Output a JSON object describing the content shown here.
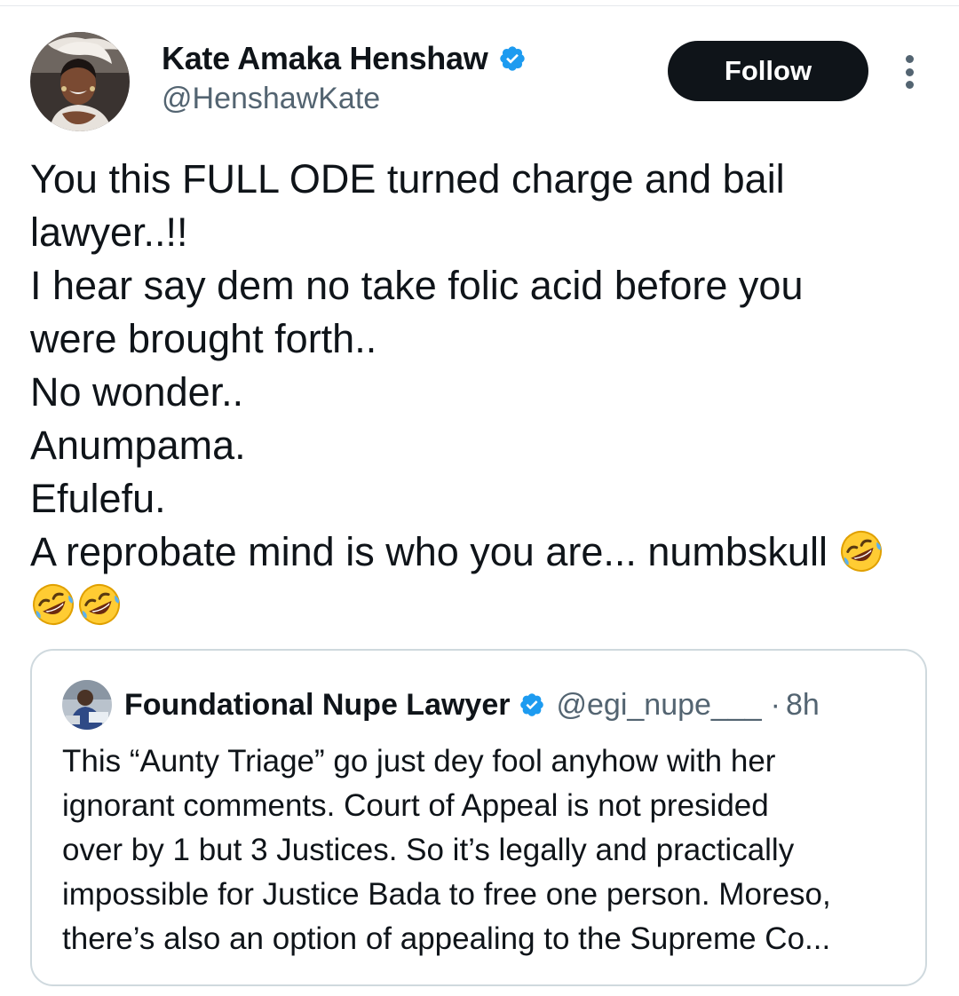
{
  "author": {
    "display_name": "Kate Amaka Henshaw",
    "handle": "@HenshawKate",
    "verified": true,
    "avatar_icon": "profile-photo"
  },
  "follow_button": {
    "label": "Follow"
  },
  "more_button": {
    "icon": "more-options-icon"
  },
  "tweet": {
    "lines": [
      "You this FULL ODE turned charge and bail",
      "lawyer..!!",
      "I hear say dem no take folic acid before you",
      "were brought forth..",
      "No wonder..",
      "Anumpama.",
      "Efulefu.",
      "A reprobate mind is who you are... numbskull"
    ],
    "emoji": "rolling-on-the-floor-laughing",
    "emoji_count_inline": 1,
    "emoji_count_next_line": 2
  },
  "quoted_tweet": {
    "display_name": "Foundational Nupe Lawyer",
    "handle": "@egi_nupe___",
    "separator": "·",
    "time": "8h",
    "verified": true,
    "lines": [
      "This “Aunty Triage” go just dey fool anyhow with her",
      "ignorant comments. Court of Appeal is not presided",
      "over by 1 but 3 Justices. So it’s legally and practically",
      "impossible for Justice Bada to free one person. Moreso,",
      "there’s also an option of appealing to the Supreme Co..."
    ]
  },
  "colors": {
    "text": "#0f1419",
    "secondary": "#536471",
    "verified_blue": "#1d9bf0",
    "button_bg": "#0f1419",
    "border": "#cfd9de"
  }
}
